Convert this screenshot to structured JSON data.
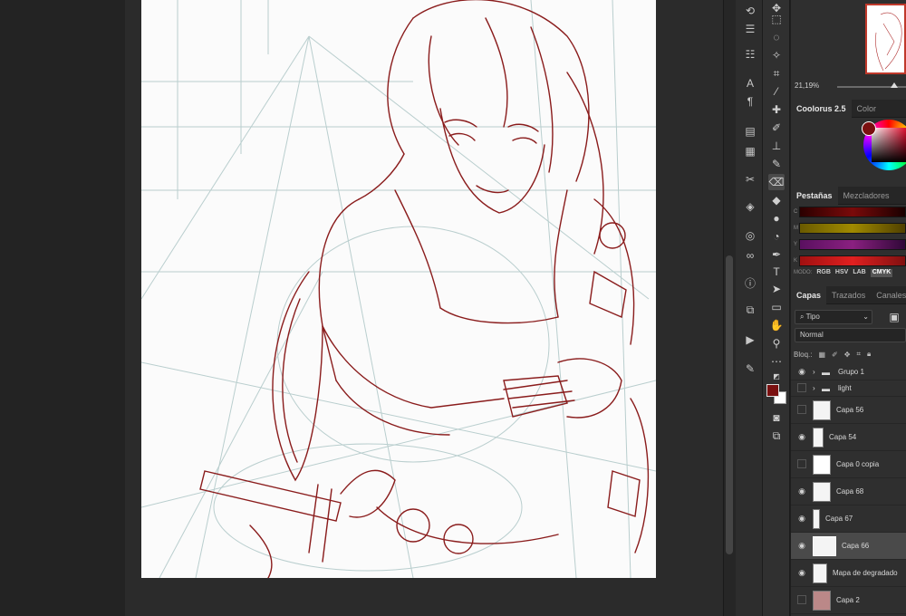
{
  "navigator": {
    "zoom": "21,19%"
  },
  "color_panel": {
    "tab_active": "Coolorus 2.5",
    "tab_other": "Color"
  },
  "swatches_panel": {
    "tab_active": "Pestañas",
    "tab_other": "Mezcladores",
    "slider_labels": [
      "C",
      "M",
      "Y",
      "K"
    ],
    "mode_label": "MODO:",
    "modes": [
      "RGB",
      "HSV",
      "LAB",
      "CMYK"
    ],
    "selected_mode": "CMYK",
    "slider_gradients": [
      "#2b0000,#7a0a0a,#1a0000",
      "#6a5a00,#a08a00,#504000",
      "#5a1060,#8a2080,#300838",
      "#a01010,#e02020,#801010"
    ]
  },
  "layers_panel": {
    "tabs": [
      "Capas",
      "Trazados",
      "Canales"
    ],
    "filter": "Tipo",
    "blend_mode": "Normal",
    "lock_label": "Bloq.:",
    "layers": [
      {
        "name": "Grupo 1",
        "type": "group",
        "visible": true
      },
      {
        "name": "light",
        "type": "group",
        "visible": false
      },
      {
        "name": "Capa 56",
        "type": "layer",
        "visible": false
      },
      {
        "name": "Capa 54",
        "type": "layer",
        "visible": true
      },
      {
        "name": "Capa 0 copia",
        "type": "layer",
        "visible": false
      },
      {
        "name": "Capa 68",
        "type": "layer",
        "visible": true
      },
      {
        "name": "Capa 67",
        "type": "layer",
        "visible": true
      },
      {
        "name": "Capa 66",
        "type": "layer",
        "visible": true,
        "selected": true
      },
      {
        "name": "Mapa de degradado",
        "type": "layer",
        "visible": true
      },
      {
        "name": "Capa 2",
        "type": "layer",
        "visible": false
      }
    ]
  },
  "colors": {
    "foreground": "#7a1010",
    "background": "#ffffff",
    "sketch_line": "#8a1c1c",
    "guide_line": "#a9c3c3"
  }
}
